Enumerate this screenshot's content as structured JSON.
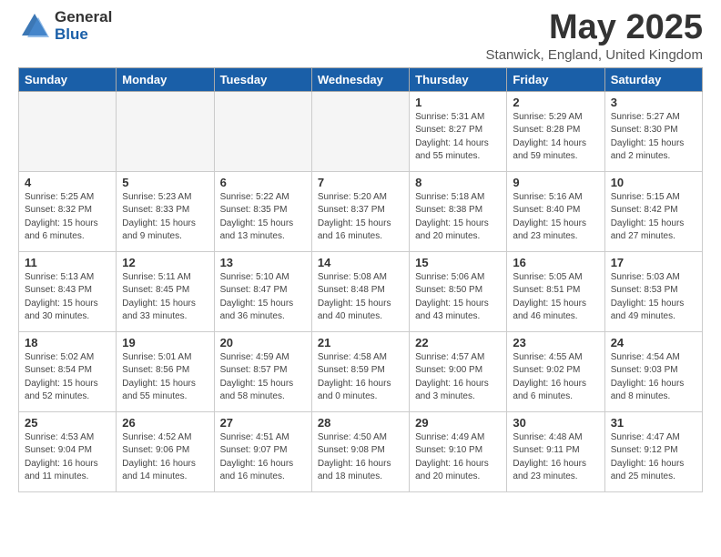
{
  "header": {
    "logo_general": "General",
    "logo_blue": "Blue",
    "month_title": "May 2025",
    "location": "Stanwick, England, United Kingdom"
  },
  "calendar": {
    "days_of_week": [
      "Sunday",
      "Monday",
      "Tuesday",
      "Wednesday",
      "Thursday",
      "Friday",
      "Saturday"
    ],
    "weeks": [
      [
        {
          "day": "",
          "info": ""
        },
        {
          "day": "",
          "info": ""
        },
        {
          "day": "",
          "info": ""
        },
        {
          "day": "",
          "info": ""
        },
        {
          "day": "1",
          "info": "Sunrise: 5:31 AM\nSunset: 8:27 PM\nDaylight: 14 hours\nand 55 minutes."
        },
        {
          "day": "2",
          "info": "Sunrise: 5:29 AM\nSunset: 8:28 PM\nDaylight: 14 hours\nand 59 minutes."
        },
        {
          "day": "3",
          "info": "Sunrise: 5:27 AM\nSunset: 8:30 PM\nDaylight: 15 hours\nand 2 minutes."
        }
      ],
      [
        {
          "day": "4",
          "info": "Sunrise: 5:25 AM\nSunset: 8:32 PM\nDaylight: 15 hours\nand 6 minutes."
        },
        {
          "day": "5",
          "info": "Sunrise: 5:23 AM\nSunset: 8:33 PM\nDaylight: 15 hours\nand 9 minutes."
        },
        {
          "day": "6",
          "info": "Sunrise: 5:22 AM\nSunset: 8:35 PM\nDaylight: 15 hours\nand 13 minutes."
        },
        {
          "day": "7",
          "info": "Sunrise: 5:20 AM\nSunset: 8:37 PM\nDaylight: 15 hours\nand 16 minutes."
        },
        {
          "day": "8",
          "info": "Sunrise: 5:18 AM\nSunset: 8:38 PM\nDaylight: 15 hours\nand 20 minutes."
        },
        {
          "day": "9",
          "info": "Sunrise: 5:16 AM\nSunset: 8:40 PM\nDaylight: 15 hours\nand 23 minutes."
        },
        {
          "day": "10",
          "info": "Sunrise: 5:15 AM\nSunset: 8:42 PM\nDaylight: 15 hours\nand 27 minutes."
        }
      ],
      [
        {
          "day": "11",
          "info": "Sunrise: 5:13 AM\nSunset: 8:43 PM\nDaylight: 15 hours\nand 30 minutes."
        },
        {
          "day": "12",
          "info": "Sunrise: 5:11 AM\nSunset: 8:45 PM\nDaylight: 15 hours\nand 33 minutes."
        },
        {
          "day": "13",
          "info": "Sunrise: 5:10 AM\nSunset: 8:47 PM\nDaylight: 15 hours\nand 36 minutes."
        },
        {
          "day": "14",
          "info": "Sunrise: 5:08 AM\nSunset: 8:48 PM\nDaylight: 15 hours\nand 40 minutes."
        },
        {
          "day": "15",
          "info": "Sunrise: 5:06 AM\nSunset: 8:50 PM\nDaylight: 15 hours\nand 43 minutes."
        },
        {
          "day": "16",
          "info": "Sunrise: 5:05 AM\nSunset: 8:51 PM\nDaylight: 15 hours\nand 46 minutes."
        },
        {
          "day": "17",
          "info": "Sunrise: 5:03 AM\nSunset: 8:53 PM\nDaylight: 15 hours\nand 49 minutes."
        }
      ],
      [
        {
          "day": "18",
          "info": "Sunrise: 5:02 AM\nSunset: 8:54 PM\nDaylight: 15 hours\nand 52 minutes."
        },
        {
          "day": "19",
          "info": "Sunrise: 5:01 AM\nSunset: 8:56 PM\nDaylight: 15 hours\nand 55 minutes."
        },
        {
          "day": "20",
          "info": "Sunrise: 4:59 AM\nSunset: 8:57 PM\nDaylight: 15 hours\nand 58 minutes."
        },
        {
          "day": "21",
          "info": "Sunrise: 4:58 AM\nSunset: 8:59 PM\nDaylight: 16 hours\nand 0 minutes."
        },
        {
          "day": "22",
          "info": "Sunrise: 4:57 AM\nSunset: 9:00 PM\nDaylight: 16 hours\nand 3 minutes."
        },
        {
          "day": "23",
          "info": "Sunrise: 4:55 AM\nSunset: 9:02 PM\nDaylight: 16 hours\nand 6 minutes."
        },
        {
          "day": "24",
          "info": "Sunrise: 4:54 AM\nSunset: 9:03 PM\nDaylight: 16 hours\nand 8 minutes."
        }
      ],
      [
        {
          "day": "25",
          "info": "Sunrise: 4:53 AM\nSunset: 9:04 PM\nDaylight: 16 hours\nand 11 minutes."
        },
        {
          "day": "26",
          "info": "Sunrise: 4:52 AM\nSunset: 9:06 PM\nDaylight: 16 hours\nand 14 minutes."
        },
        {
          "day": "27",
          "info": "Sunrise: 4:51 AM\nSunset: 9:07 PM\nDaylight: 16 hours\nand 16 minutes."
        },
        {
          "day": "28",
          "info": "Sunrise: 4:50 AM\nSunset: 9:08 PM\nDaylight: 16 hours\nand 18 minutes."
        },
        {
          "day": "29",
          "info": "Sunrise: 4:49 AM\nSunset: 9:10 PM\nDaylight: 16 hours\nand 20 minutes."
        },
        {
          "day": "30",
          "info": "Sunrise: 4:48 AM\nSunset: 9:11 PM\nDaylight: 16 hours\nand 23 minutes."
        },
        {
          "day": "31",
          "info": "Sunrise: 4:47 AM\nSunset: 9:12 PM\nDaylight: 16 hours\nand 25 minutes."
        }
      ]
    ]
  }
}
